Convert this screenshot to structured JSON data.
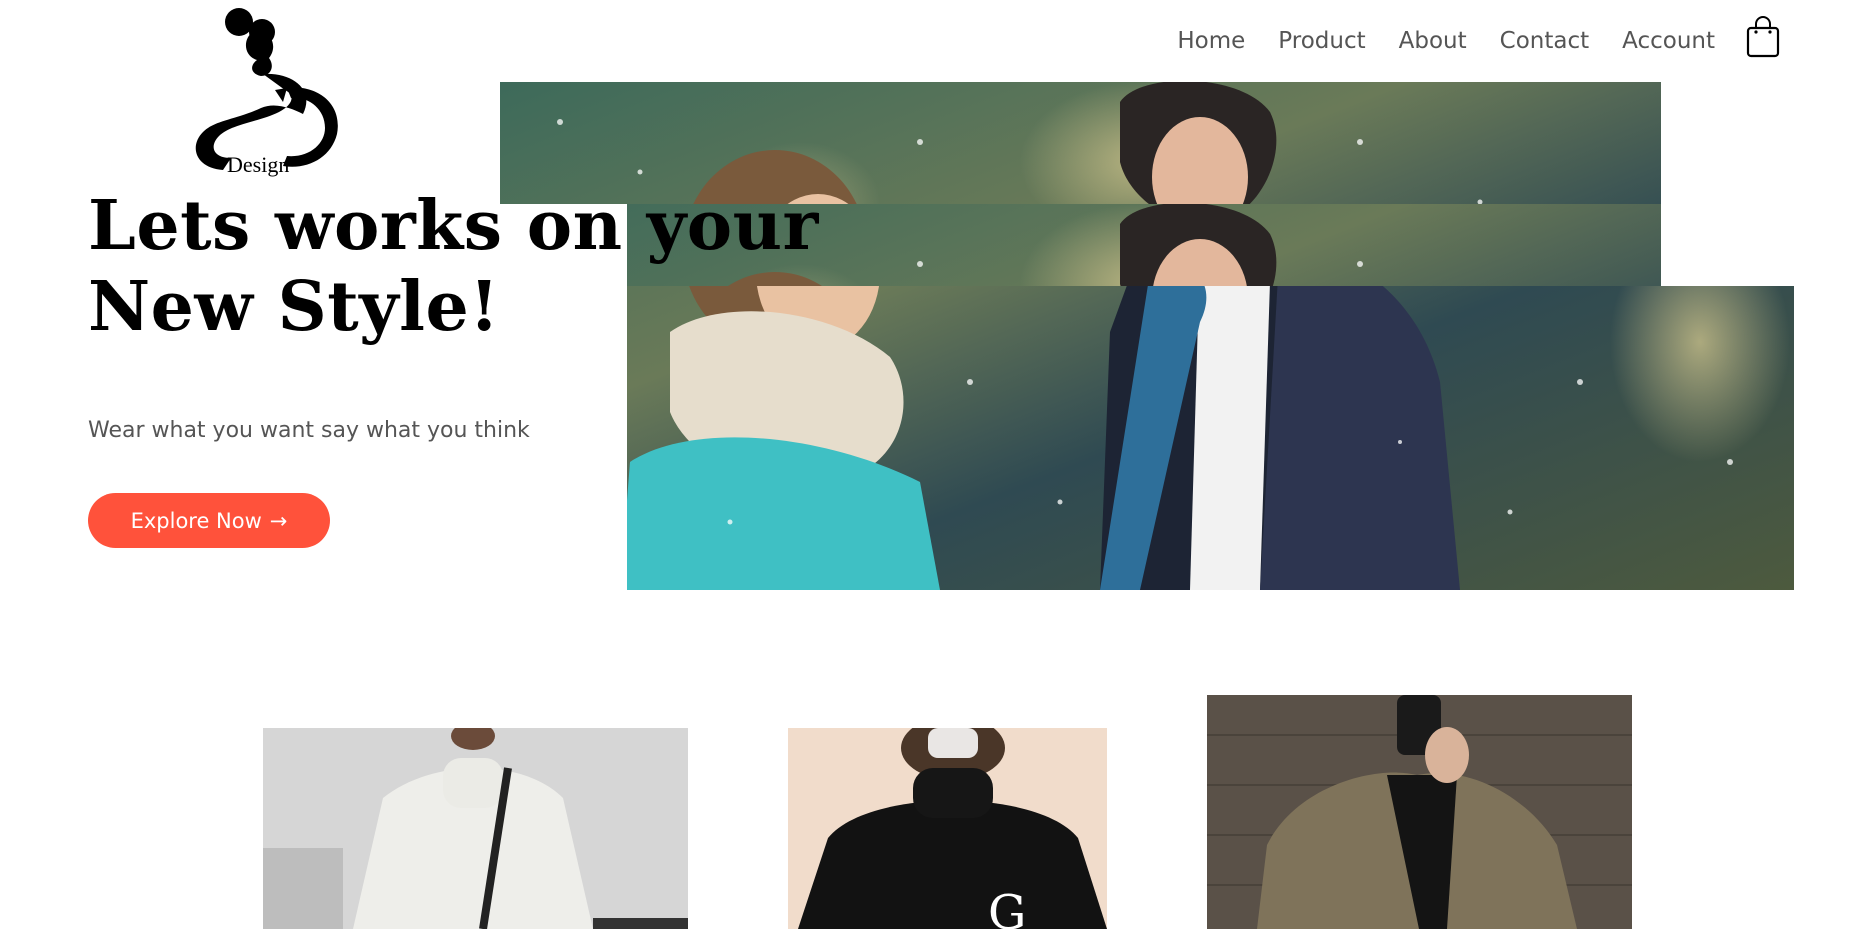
{
  "brand": {
    "logo_text": "Design",
    "logo_icon": "fashion-figure-logo"
  },
  "nav": {
    "items": [
      {
        "label": "Home"
      },
      {
        "label": "Product"
      },
      {
        "label": "About"
      },
      {
        "label": "Contact"
      },
      {
        "label": "Account"
      }
    ],
    "cart_icon": "shopping-bag-icon"
  },
  "hero": {
    "headline_line1": "Lets works on your",
    "headline_line2": "New Style!",
    "subtext": "Wear what you want say what you think",
    "cta_label": "Explore Now",
    "cta_arrow": "→",
    "image_icon": "couple-in-snow-photo"
  },
  "products": [
    {
      "image": "white-turtleneck-sweater-photo"
    },
    {
      "image": "black-turtleneck-sweater-photo"
    },
    {
      "image": "olive-overcoat-photo"
    }
  ],
  "colors": {
    "accent": "#ff523b",
    "text_muted": "#555555",
    "heading": "#000000"
  }
}
